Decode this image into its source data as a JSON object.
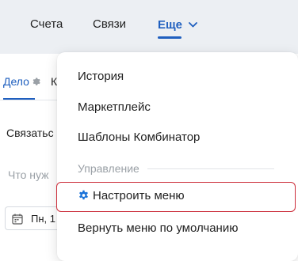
{
  "topnav": {
    "accounts": "Счета",
    "links": "Связи",
    "more": "Еще"
  },
  "main": {
    "tab_case": "Дело",
    "tab_k": "К",
    "connect": "Связатьс",
    "what": "Что нуж",
    "date": "Пн, 1"
  },
  "menu": {
    "history": "История",
    "marketplace": "Маркетплейс",
    "templates": "Шаблоны Комбинатор",
    "section": "Управление",
    "configure": "Настроить меню",
    "reset": "Вернуть меню по умолчанию"
  },
  "colors": {
    "accent": "#1f5fbf",
    "highlight_border": "#cc2e3b"
  },
  "icons": [
    "chevron-down-icon",
    "gear-icon",
    "calendar-icon"
  ]
}
